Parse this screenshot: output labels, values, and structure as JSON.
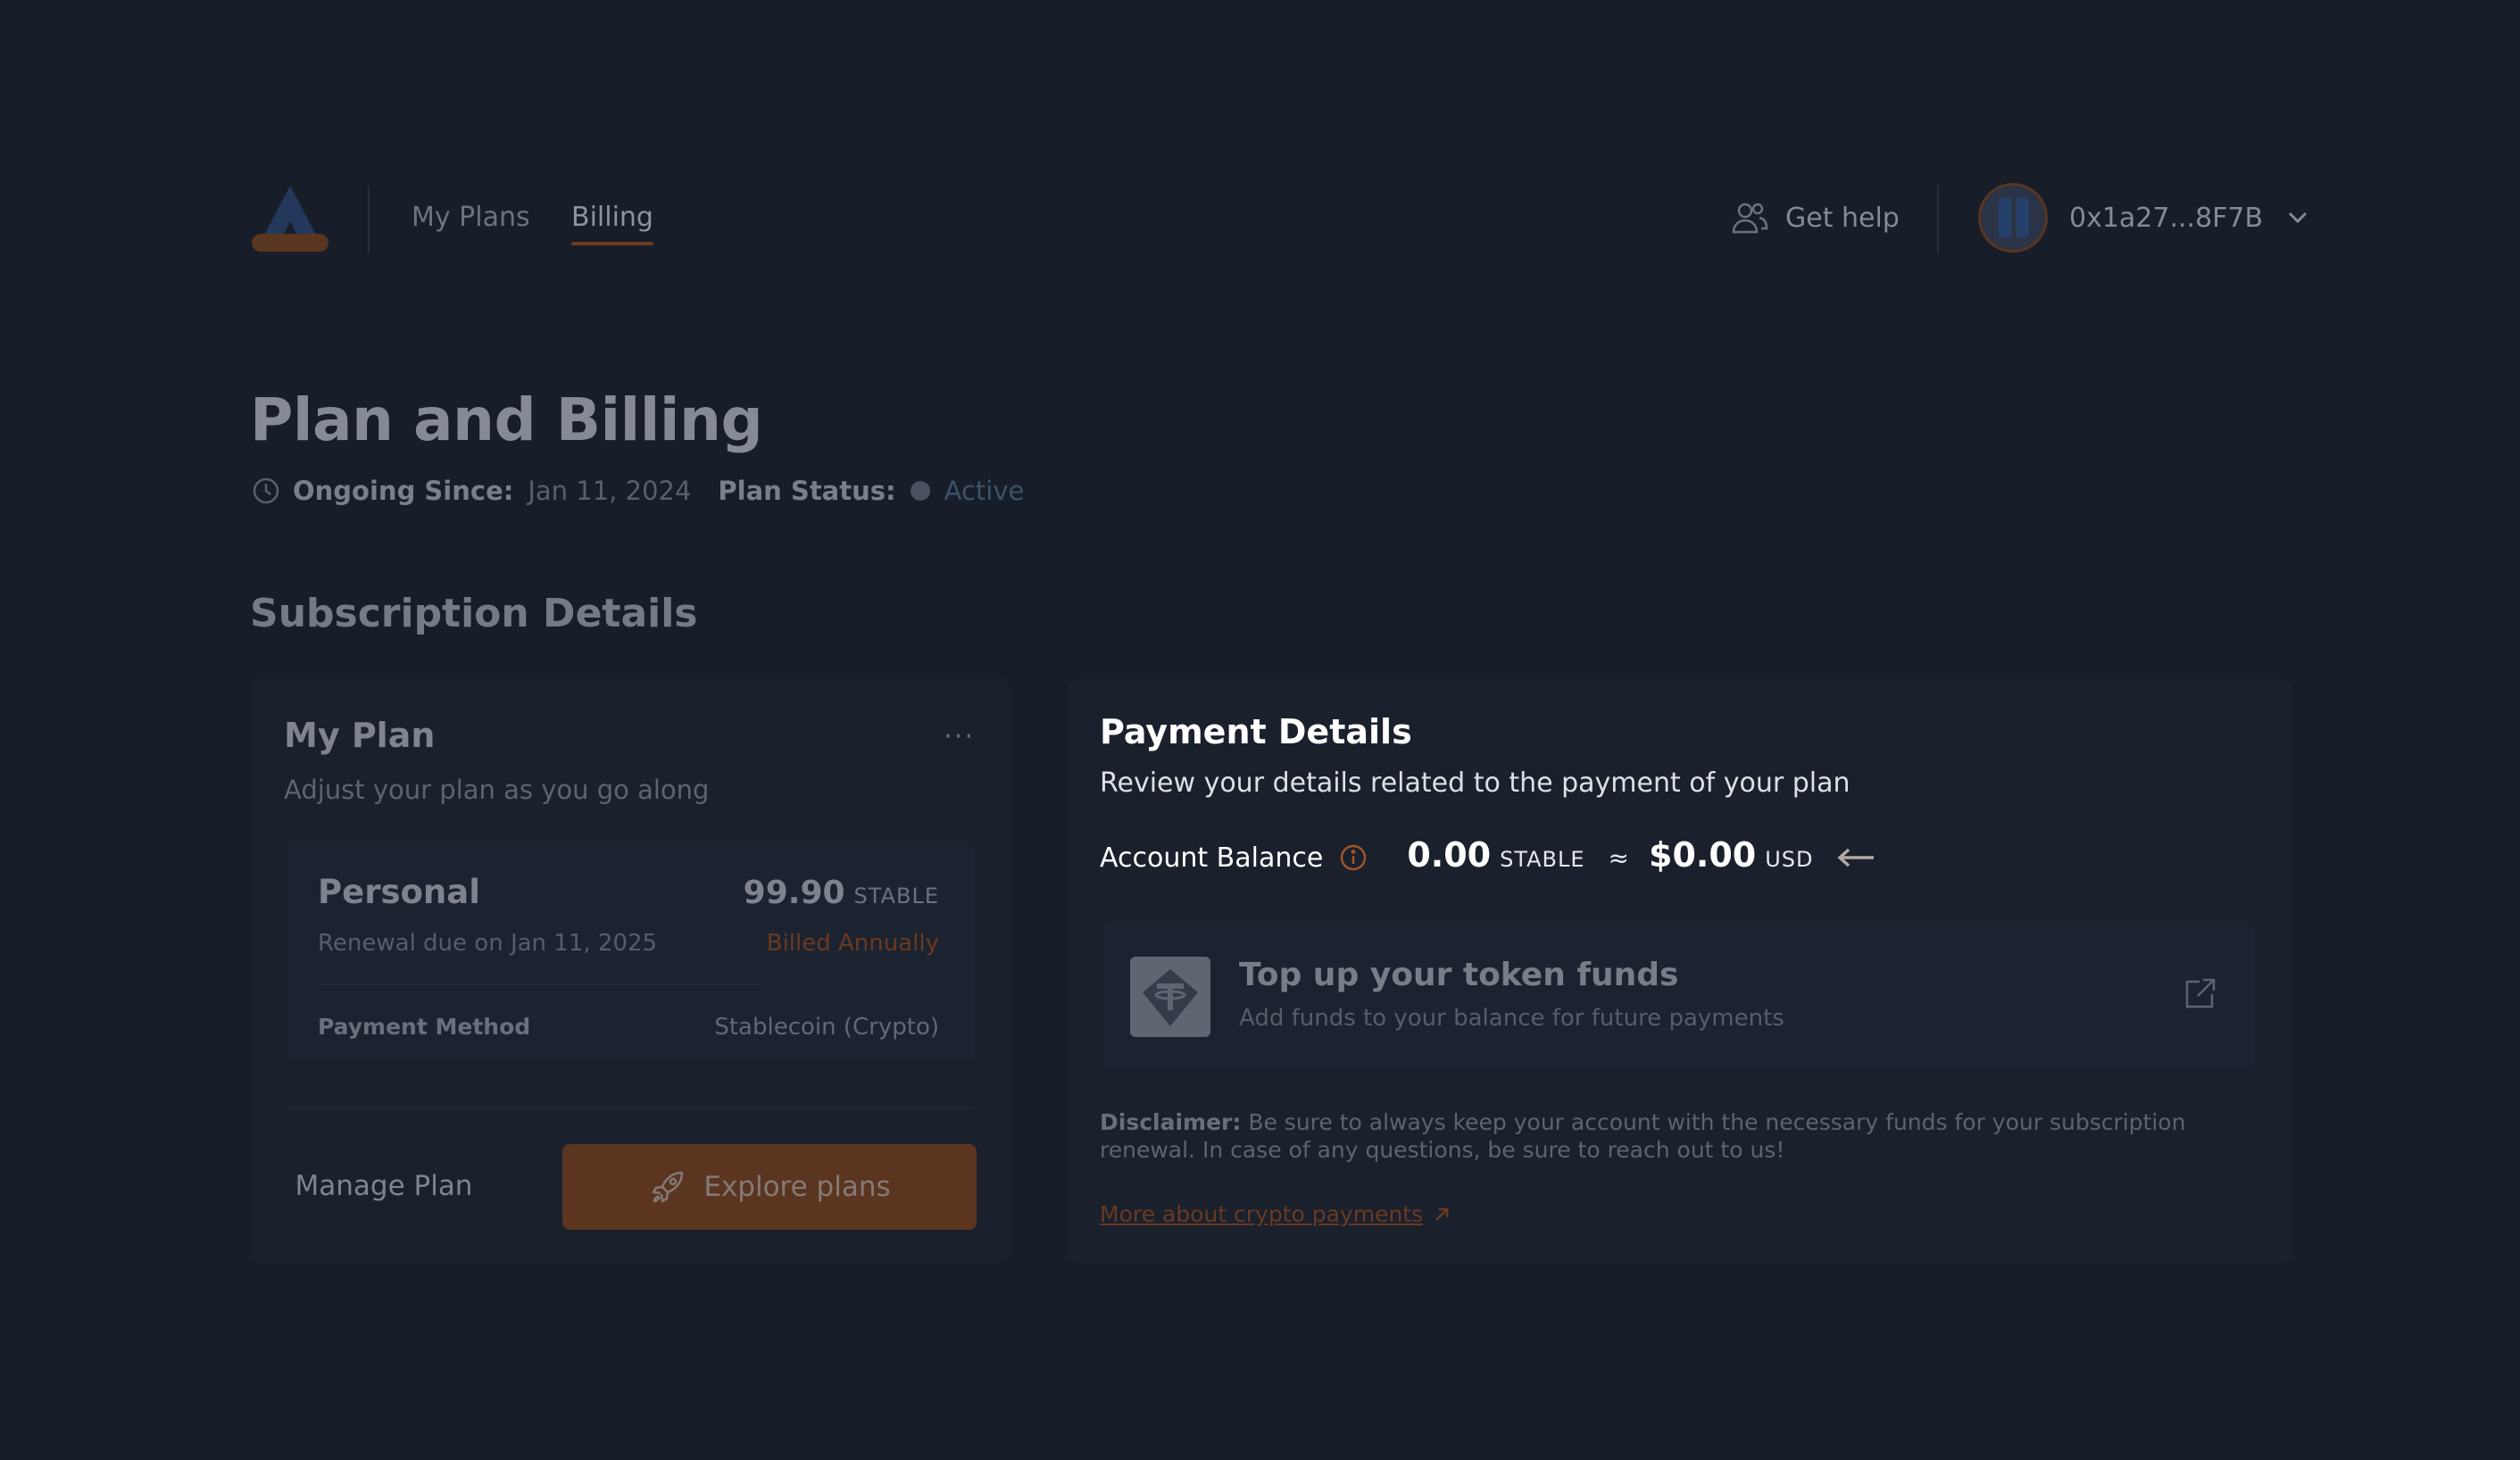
{
  "nav": {
    "tabs": [
      {
        "label": "My Plans",
        "active": false
      },
      {
        "label": "Billing",
        "active": true
      }
    ],
    "help_label": "Get help",
    "account_address": "0x1a27...8F7B",
    "icons": [
      "logo",
      "users-icon",
      "avatar",
      "chevron-down-icon"
    ]
  },
  "header": {
    "title": "Plan and Billing",
    "ongoing_since_label": "Ongoing Since:",
    "ongoing_since_value": "Jan 11, 2024",
    "plan_status_label": "Plan Status:",
    "plan_status_value": "Active"
  },
  "subscription": {
    "section_title": "Subscription Details",
    "my_plan": {
      "title": "My Plan",
      "subtitle": "Adjust your plan as you go along",
      "more_label": "···",
      "plan_name": "Personal",
      "price": "99.90",
      "price_unit": "STABLE",
      "renewal": "Renewal due on Jan 11, 2025",
      "billing_cycle": "Billed Annually",
      "payment_method_label": "Payment Method",
      "payment_method_value": "Stablecoin (Crypto)",
      "manage_label": "Manage Plan",
      "explore_label": "Explore plans"
    },
    "payment": {
      "title": "Payment Details",
      "subtitle": "Review your details related to the payment of your plan",
      "balance_label": "Account Balance",
      "balance_amount": "0.00",
      "balance_unit": "STABLE",
      "approx_symbol": "≈",
      "usd_amount": "$0.00",
      "usd_unit": "USD",
      "topup_title": "Top up your token funds",
      "topup_subtitle": "Add funds to your balance for future payments",
      "disclaimer_label": "Disclaimer:",
      "disclaimer_text": " Be sure to always keep your account with the necessary funds for your subscription renewal. In case of any questions, be sure to reach out to us!",
      "more_link": "More about crypto payments"
    }
  },
  "colors": {
    "background": "#171d29",
    "card": "#1a202c",
    "accent": "#5b3520",
    "accent_text": "#6a3a22"
  }
}
